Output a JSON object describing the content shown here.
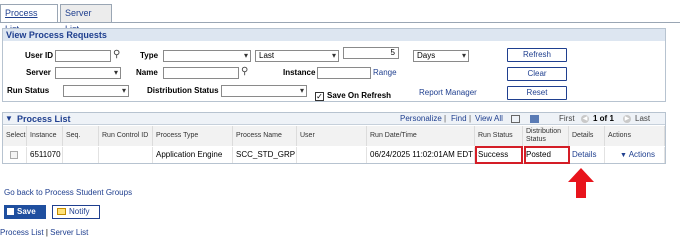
{
  "tabs": {
    "process_list": "Process List",
    "server_list": "Server List"
  },
  "view_title": "View Process Requests",
  "form": {
    "user_id_label": "User ID",
    "user_id_value": "",
    "type_label": "Type",
    "type_value": "",
    "last_value": "Last",
    "count_value": "5",
    "unit_value": "Days",
    "refresh": "Refresh",
    "server_label": "Server",
    "server_value": "",
    "name_label": "Name",
    "name_value": "",
    "instance_label": "Instance",
    "instance_value": "",
    "range": "Range",
    "clear": "Clear",
    "run_status_label": "Run Status",
    "run_status_value": "",
    "dist_status_label": "Distribution Status",
    "dist_status_value": "",
    "save_on_refresh": "Save On Refresh",
    "report_manager": "Report Manager",
    "reset": "Reset"
  },
  "grid": {
    "title": "Process List",
    "personalize": "Personalize",
    "find": "Find",
    "view_all": "View All",
    "sep1": "|",
    "sep2": "|",
    "first": "First",
    "range_text": "1 of 1",
    "last": "Last",
    "columns": [
      "Select",
      "Instance",
      "Seq.",
      "Run Control ID",
      "Process Type",
      "Process Name",
      "User",
      "Run Date/Time",
      "Run Status",
      "Distribution Status",
      "Details",
      "Actions"
    ],
    "row": {
      "select": "",
      "instance": "6511070",
      "seq": "",
      "run_control_id": "",
      "process_type": "Application Engine",
      "process_name": "SCC_STD_GRP",
      "user": "",
      "run_datetime": "06/24/2025 11:02:01AM EDT",
      "run_status": "Success",
      "dist_status": "Posted",
      "details": "Details",
      "actions": "Actions"
    }
  },
  "go_back": "Go back to Process Student Groups",
  "footer": {
    "save": "Save",
    "notify": "Notify",
    "process_list": "Process List",
    "separator": "|",
    "server_list": "Server List"
  },
  "colors": {
    "accent": "#1f3f8f",
    "highlight": "#d41d26"
  }
}
